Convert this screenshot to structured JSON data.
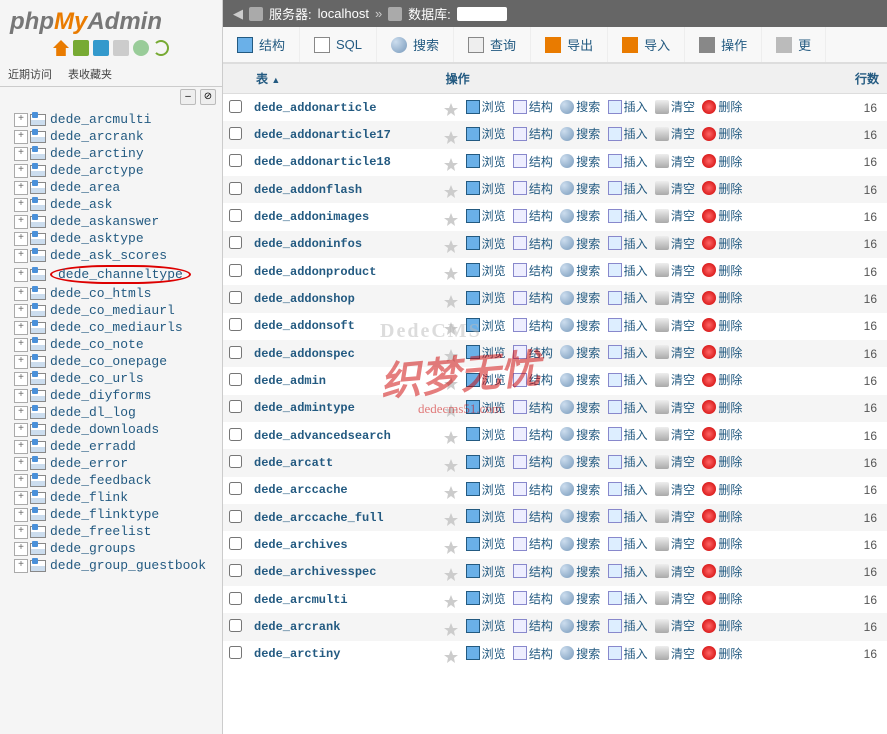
{
  "logo": {
    "php": "php",
    "my": "My",
    "admin": "Admin"
  },
  "sidebar": {
    "tab_recent": "近期访问",
    "tab_favorites": "表收藏夹",
    "tool_minus": "–",
    "tool_link": "⊘",
    "tree": [
      "dede_arcmulti",
      "dede_arcrank",
      "dede_arctiny",
      "dede_arctype",
      "dede_area",
      "dede_ask",
      "dede_askanswer",
      "dede_asktype",
      "dede_ask_scores",
      "dede_channeltype",
      "dede_co_htmls",
      "dede_co_mediaurl",
      "dede_co_mediaurls",
      "dede_co_note",
      "dede_co_onepage",
      "dede_co_urls",
      "dede_diyforms",
      "dede_dl_log",
      "dede_downloads",
      "dede_erradd",
      "dede_error",
      "dede_feedback",
      "dede_flink",
      "dede_flinktype",
      "dede_freelist",
      "dede_groups",
      "dede_group_guestbook"
    ],
    "circled": "dede_channeltype"
  },
  "breadcrumb": {
    "server_label": "服务器:",
    "server_value": "localhost",
    "db_label": "数据库:",
    "separator": "»"
  },
  "tabs": {
    "structure": "结构",
    "sql": "SQL",
    "search": "搜索",
    "query": "查询",
    "export": "导出",
    "import": "导入",
    "operations": "操作",
    "more": "更"
  },
  "table": {
    "header_table": "表",
    "header_action": "操作",
    "header_rows": "行数",
    "sort_indicator": "▲",
    "actions": {
      "browse": "浏览",
      "structure": "结构",
      "search": "搜索",
      "insert": "插入",
      "empty": "清空",
      "drop": "删除"
    },
    "rows_sample": "16",
    "tables": [
      "dede_addonarticle",
      "dede_addonarticle17",
      "dede_addonarticle18",
      "dede_addonflash",
      "dede_addonimages",
      "dede_addoninfos",
      "dede_addonproduct",
      "dede_addonshop",
      "dede_addonsoft",
      "dede_addonspec",
      "dede_admin",
      "dede_admintype",
      "dede_advancedsearch",
      "dede_arcatt",
      "dede_arccache",
      "dede_arccache_full",
      "dede_archives",
      "dede_archivesspec",
      "dede_arcmulti",
      "dede_arcrank",
      "dede_arctiny"
    ]
  },
  "watermark": {
    "cn": "织梦无忧",
    "en": "DedeCMS",
    "url": "dedecms51.com"
  }
}
